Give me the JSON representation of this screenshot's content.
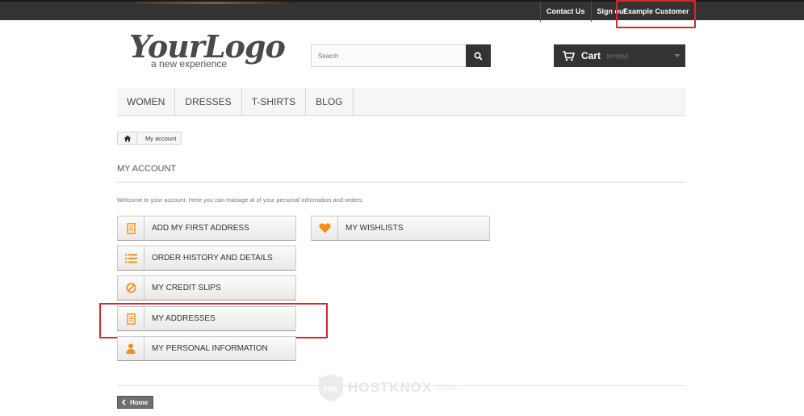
{
  "topbar": {
    "links": [
      "Contact Us",
      "Sign out"
    ],
    "customer": "Example Customer"
  },
  "logo": {
    "main": "YourLogo",
    "tagline": "a new experience"
  },
  "search": {
    "placeholder": "Search",
    "icon": "search-icon"
  },
  "cart": {
    "label": "Cart",
    "status": "(empty)",
    "icon": "cart-icon"
  },
  "menu": {
    "items": [
      "WOMEN",
      "DRESSES",
      "T-SHIRTS",
      "BLOG"
    ]
  },
  "breadcrumb": {
    "home_icon": "home-icon",
    "current": "My account"
  },
  "page": {
    "title": "MY ACCOUNT",
    "welcome": "Welcome to your account. Here you can manage al of your personal information and orders."
  },
  "account_links": {
    "left": [
      {
        "label": "ADD MY FIRST ADDRESS",
        "icon": "address-book-icon"
      },
      {
        "label": "ORDER HISTORY AND DETAILS",
        "icon": "list-icon"
      },
      {
        "label": "MY CREDIT SLIPS",
        "icon": "ban-icon"
      },
      {
        "label": "MY ADDRESSES",
        "icon": "address-book-icon"
      },
      {
        "label": "MY PERSONAL INFORMATION",
        "icon": "user-icon"
      }
    ],
    "right": [
      {
        "label": "MY WISHLISTS",
        "icon": "heart-icon"
      }
    ]
  },
  "footer": {
    "home_label": "Home"
  },
  "watermark": {
    "text": "HOSTKNOX",
    "suffix": ".COM"
  },
  "colors": {
    "accent": "#f39014",
    "topbar": "#333333",
    "highlight": "#d02a2a"
  }
}
